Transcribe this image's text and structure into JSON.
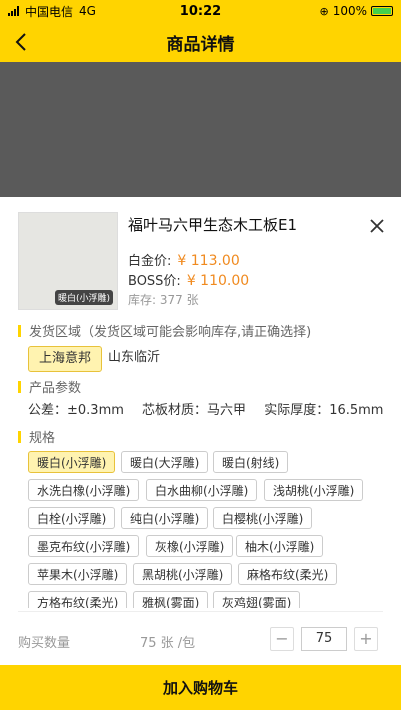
{
  "status": {
    "carrier": "中国电信",
    "network": "4G",
    "time": "10:22",
    "battery": "100%"
  },
  "header": {
    "title": "商品详情"
  },
  "product": {
    "name": "福叶马六甲生态木工板E1",
    "thumb_tag": "暖白(小浮雕)",
    "gold_label": "白金价:",
    "gold_price": "¥ 113.00",
    "boss_label": "BOSS价:",
    "boss_price": "¥ 110.00",
    "stock": "库存: 377 张"
  },
  "shipping": {
    "label": "发货区域（发货区域可能会影响库存,请正确选择)",
    "options": [
      "上海意邦",
      "山东临沂"
    ]
  },
  "params": {
    "label": "产品参数",
    "tolerance": "公差：±0.3mm",
    "core": "芯板材质：马六甲",
    "thickness": "实际厚度：16.5mm"
  },
  "specs": {
    "label": "规格",
    "items": [
      "暖白(小浮雕)",
      "暖白(大浮雕)",
      "暖白(射线)",
      "水洗白橡(小浮雕)",
      "白水曲柳(小浮雕)",
      "浅胡桃(小浮雕)",
      "白栓(小浮雕)",
      "纯白(小浮雕)",
      "白樱桃(小浮雕)",
      "墨克布纹(小浮雕)",
      "灰橡(小浮雕)",
      "柚木(小浮雕)",
      "苹果木(小浮雕)",
      "黑胡桃(小浮雕)",
      "麻格布纹(柔光)",
      "方格布纹(柔光)",
      "雅枫(雾面)",
      "灰鸡翅(雾面)"
    ]
  },
  "quantity": {
    "label": "购买数量",
    "unit": "75 张 /包",
    "minus": "−",
    "value": "75",
    "plus": "+"
  },
  "cart": {
    "label": "加入购物车"
  }
}
